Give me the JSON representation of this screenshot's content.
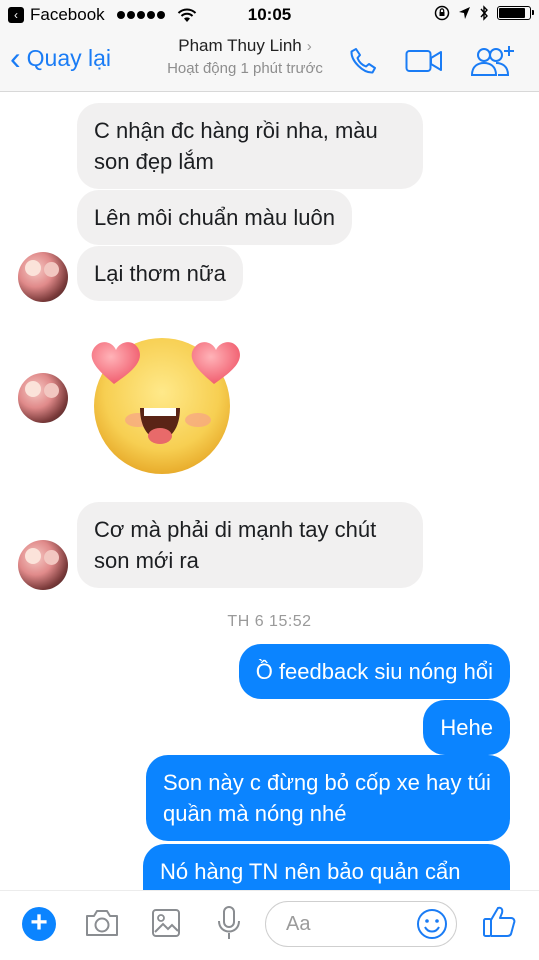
{
  "status_bar": {
    "back_app": "Facebook",
    "time": "10:05",
    "back_app_icon": "back-chevron-icon",
    "battery_level": 0.85
  },
  "header": {
    "back_label": "Quay lại",
    "contact_name": "Pham Thuy Linh",
    "presence": "Hoạt động 1 phút trước",
    "icons": [
      "phone-icon",
      "video-camera-icon",
      "add-people-icon"
    ]
  },
  "messages": {
    "m1": "C nhận đc hàng rồi nha, màu son đẹp lắm",
    "m2": "Lên môi chuẩn màu luôn",
    "m3": "Lại thơm nữa",
    "emoji": "heart-eyes-emoji",
    "m4": "Cơ mà phải di mạnh tay chút son mới ra",
    "timestamp": "TH 6 15:52",
    "o1": "Ồ feedback siu nóng hổi",
    "o2": "Hehe",
    "o3": "Son này c đừng bỏ cốp xe hay túi quần mà nóng nhé",
    "o4": "Nó hàng TN nên bảo quản cẩn"
  },
  "composer": {
    "placeholder": "Aa",
    "icons": [
      "plus-icon",
      "camera-icon",
      "image-icon",
      "microphone-icon",
      "smiley-icon",
      "like-icon"
    ]
  },
  "colors": {
    "accent": "#0b84ff",
    "incoming_bubble": "#f1f0f0",
    "header_bg": "#f7f7f7"
  }
}
